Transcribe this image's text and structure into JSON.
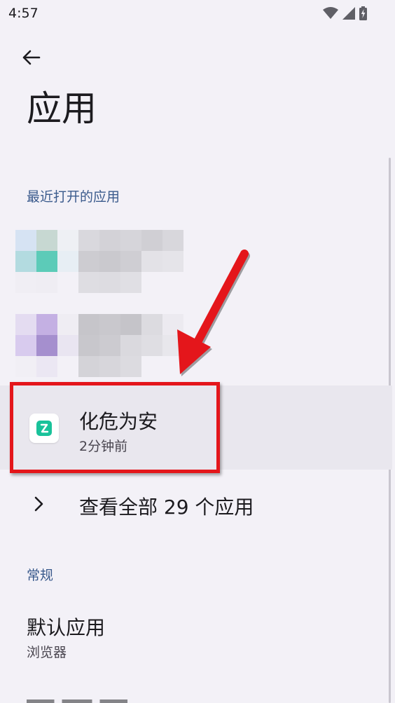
{
  "status_bar": {
    "time": "4:57",
    "icons": [
      "wifi-icon",
      "signal-icon",
      "battery-charging-icon"
    ]
  },
  "header": {
    "back_icon": "arrow-left-icon",
    "title": "应用"
  },
  "recent_section": {
    "header": "最近打开的应用",
    "apps": [
      {
        "name": "化危为安",
        "subtitle": "2分钟前",
        "icon": "app-logo-icon",
        "icon_color": "#19c29a"
      }
    ],
    "see_all_label": "查看全部 29 个应用",
    "see_all_icon": "chevron-right-icon"
  },
  "general_section": {
    "header": "常规",
    "items": [
      {
        "title": "默认应用",
        "subtitle": "浏览器"
      }
    ]
  },
  "colors": {
    "background": "#f3f1f7",
    "section_header": "#3a5a8c",
    "highlight_row": "#e9e7ee",
    "annotation_red": "#e4161b"
  }
}
